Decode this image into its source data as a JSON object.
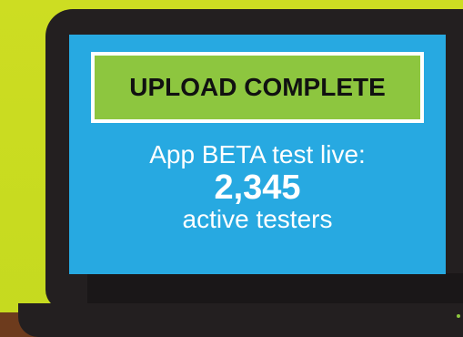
{
  "banner": {
    "title": "UPLOAD COMPLETE"
  },
  "screen": {
    "line1": "App BETA test live:",
    "count": "2,345",
    "line3": "active testers"
  },
  "colors": {
    "background": "#cddd22",
    "laptop": "#231f20",
    "screen": "#27a9e1",
    "banner": "#8dc63f",
    "desk": "#6d3b1d"
  }
}
